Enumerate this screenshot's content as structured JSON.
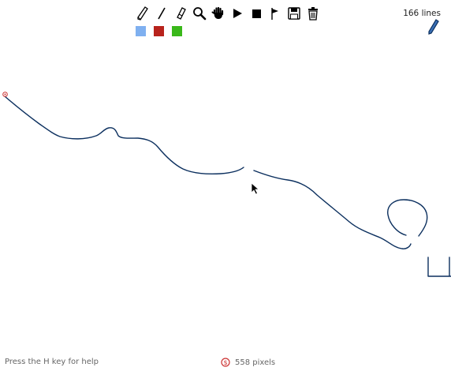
{
  "toolbar": {
    "tools": [
      {
        "name": "pencil-tool",
        "icon": "pencil-icon"
      },
      {
        "name": "line-tool",
        "icon": "line-icon"
      },
      {
        "name": "eraser-tool",
        "icon": "eraser-icon"
      },
      {
        "name": "zoom-tool",
        "icon": "magnifier-icon"
      },
      {
        "name": "pan-tool",
        "icon": "hand-icon"
      },
      {
        "name": "play-tool",
        "icon": "play-icon"
      },
      {
        "name": "stop-tool",
        "icon": "stop-icon"
      },
      {
        "name": "flag-tool",
        "icon": "flag-icon"
      },
      {
        "name": "save-tool",
        "icon": "floppy-disk-icon"
      },
      {
        "name": "delete-tool",
        "icon": "trash-icon"
      }
    ]
  },
  "colors": {
    "swatches": [
      "#7fb0f0",
      "#b8231c",
      "#3ab81a"
    ],
    "stroke": "#0b2f5e"
  },
  "status": {
    "line_count": "166 lines",
    "help_text": "Press the H key for help",
    "pixel_count": "558 pixels"
  }
}
